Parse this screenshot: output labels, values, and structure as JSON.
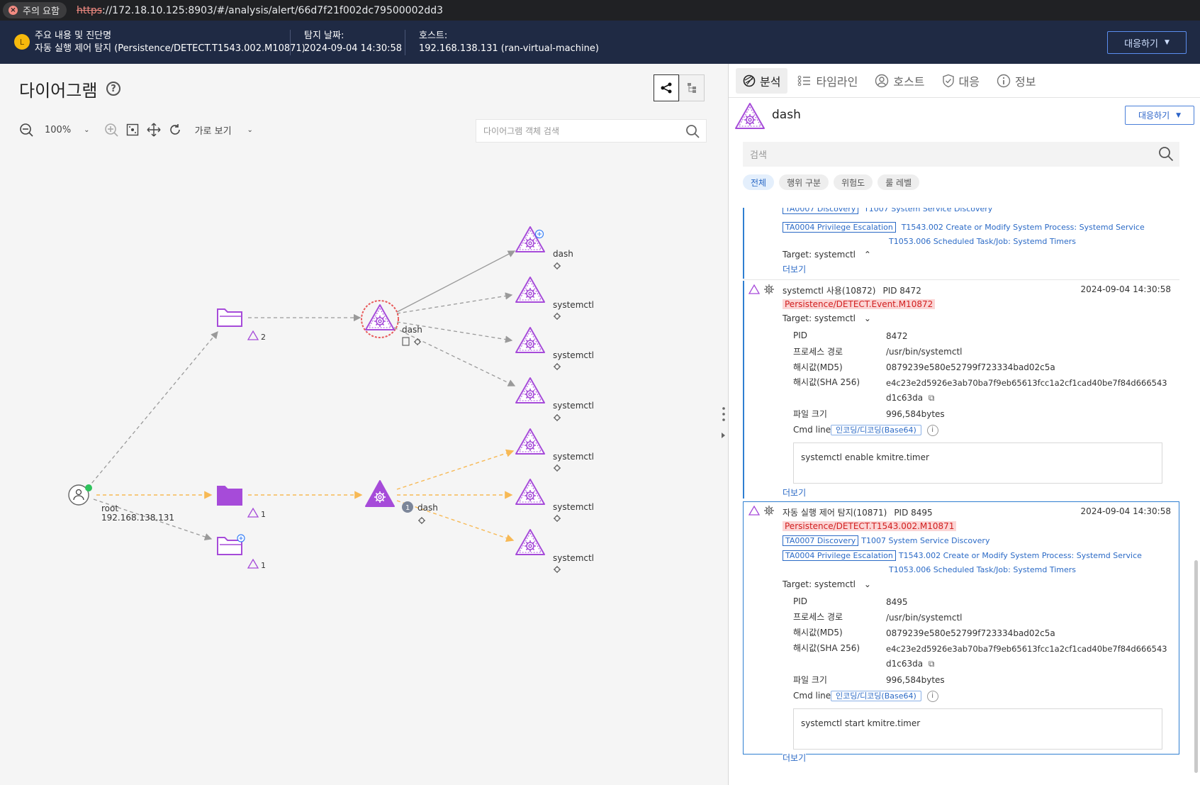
{
  "browser": {
    "warning": "주의 요함",
    "url_scheme": "https",
    "url_rest": "://172.18.10.125:8903/#/analysis/alert/66d7f21f002dc79500002dd3"
  },
  "alert": {
    "level": "L",
    "summary_label": "주요 내용 및 진단명",
    "summary_value": "자동 실행 제어 탐지 (Persistence/DETECT.T1543.002.M10871)",
    "date_label": "탐지 날짜:",
    "date_value": "2024-09-04 14:30:58",
    "host_label": "호스트:",
    "host_value": "192.168.138.131 (ran-virtual-machine)",
    "respond": "대응하기"
  },
  "diagram": {
    "title": "다이어그램",
    "zoom": "100%",
    "layout": "가로 보기",
    "search_placeholder": "다이어그램 객체 검색",
    "nodes": {
      "folder1_count": "2",
      "folder2_count": "1",
      "folder3_count": "1",
      "root_name": "root",
      "root_ip": "192.168.138.131",
      "proc1": "dash",
      "proc2": "dash",
      "proc2_badge": "1",
      "c1": "dash",
      "c2": "systemctl",
      "c3": "systemctl",
      "c4": "systemctl",
      "c5": "systemctl",
      "c6": "systemctl",
      "c7": "systemctl"
    }
  },
  "panel": {
    "tabs": [
      "분석",
      "타임라인",
      "호스트",
      "대응",
      "정보"
    ],
    "process_name": "dash",
    "respond": "대응하기",
    "search_placeholder": "검색",
    "chips": [
      "전체",
      "행위 구분",
      "위험도",
      "룰 레벨"
    ],
    "ev0": {
      "tactic1": "TA0007 Discovery",
      "tech1": "T1007 System Service Discovery",
      "tactic2": "TA0004 Privilege Escalation",
      "tech2": "T1543.002 Create or Modify System Process: Systemd Service",
      "tech3": "T1053.006 Scheduled Task/Job: Systemd Timers",
      "target": "Target: systemctl",
      "more": "더보기"
    },
    "ev1": {
      "title": "systemctl 사용(10872)",
      "pid": "PID 8472",
      "time": "2024-09-04 14:30:58",
      "rule": "Persistence/DETECT.Event.M10872",
      "target": "Target: systemctl",
      "k_pid": "PID",
      "v_pid": "8472",
      "k_path": "프로세스 경로",
      "v_path": "/usr/bin/systemctl",
      "k_md5": "해시값(MD5)",
      "v_md5": "0879239e580e52799f723334bad02c5a",
      "k_sha": "해시값(SHA 256)",
      "v_sha1": "e4c23e2d5926e3ab70ba7f9eb65613fcc1a2cf1cad40be7f84d666543",
      "v_sha2": "d1c63da",
      "k_size": "파일 크기",
      "v_size": "996,584bytes",
      "k_cmd": "Cmd line",
      "enc": "인코딩/디코딩(Base64)",
      "cmd": "systemctl enable kmitre.timer",
      "more": "더보기"
    },
    "ev2": {
      "title": "자동 실행 제어 탐지(10871)",
      "pid": "PID 8495",
      "time": "2024-09-04 14:30:58",
      "rule": "Persistence/DETECT.T1543.002.M10871",
      "tactic1": "TA0007 Discovery",
      "tech1": "T1007 System Service Discovery",
      "tactic2": "TA0004 Privilege Escalation",
      "tech2": "T1543.002 Create or Modify System Process: Systemd Service",
      "tech3": "T1053.006 Scheduled Task/Job: Systemd Timers",
      "target": "Target: systemctl",
      "k_pid": "PID",
      "v_pid": "8495",
      "k_path": "프로세스 경로",
      "v_path": "/usr/bin/systemctl",
      "k_md5": "해시값(MD5)",
      "v_md5": "0879239e580e52799f723334bad02c5a",
      "k_sha": "해시값(SHA 256)",
      "v_sha1": "e4c23e2d5926e3ab70ba7f9eb65613fcc1a2cf1cad40be7f84d666543",
      "v_sha2": "d1c63da",
      "k_size": "파일 크기",
      "v_size": "996,584bytes",
      "k_cmd": "Cmd line",
      "enc": "인코딩/디코딩(Base64)",
      "cmd": "systemctl start kmitre.timer",
      "more": "더보기"
    }
  },
  "colors": {
    "purple": "#a64bd9",
    "navy": "#1f2a44",
    "link": "#2b6ac6",
    "edge_orange": "#f7b955",
    "edge_gray": "#9a9a9a"
  }
}
